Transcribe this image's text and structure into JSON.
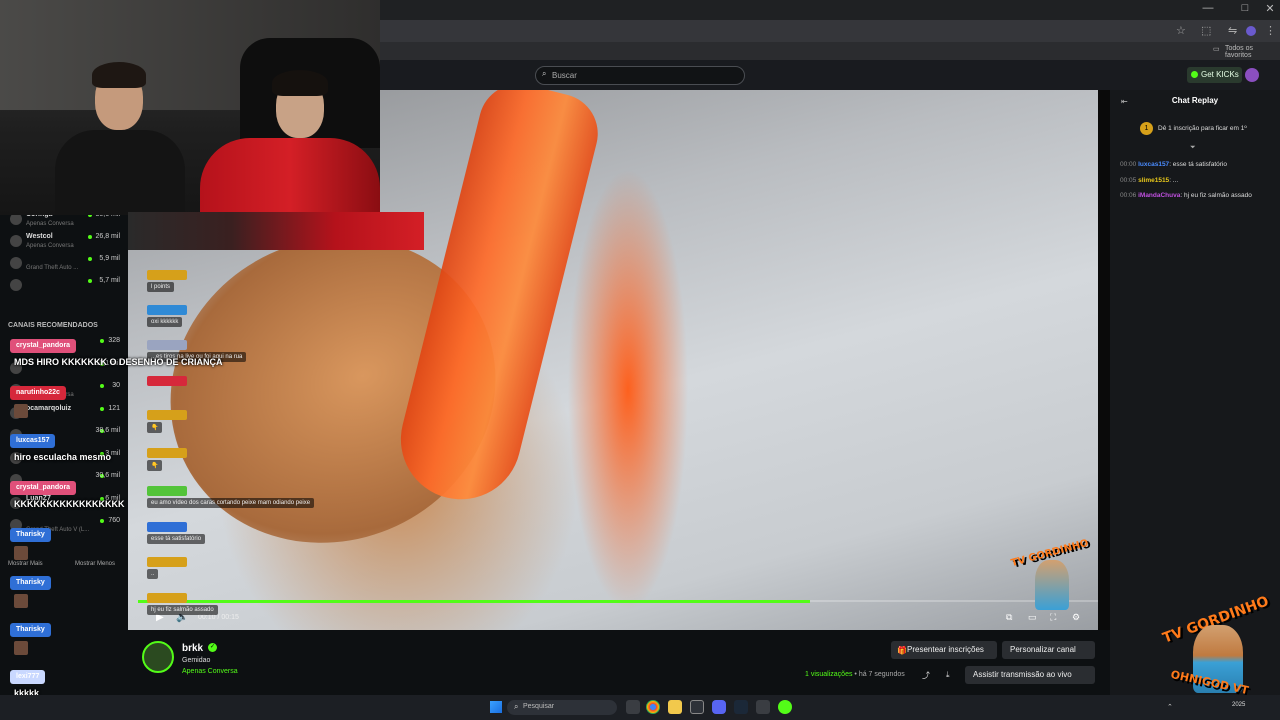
{
  "browser": {
    "window_controls": [
      "—",
      "□",
      "✕"
    ],
    "favorites_label": "Todos os favoritos"
  },
  "header": {
    "search_placeholder": "Buscar",
    "get_kicks_label": "Get KICKs"
  },
  "sidebar": {
    "followed": [
      {
        "name": "Coringa",
        "sub": "Apenas Conversa",
        "count": "30,6 mil"
      },
      {
        "name": "Westcol",
        "sub": "Apenas Conversa",
        "count": "26,8 mil"
      },
      {
        "name": "",
        "sub": "Grand Theft Auto ...",
        "count": "5,9 mil"
      },
      {
        "name": "",
        "sub": "",
        "count": "5,7 mil"
      }
    ],
    "recommended_heading": "CANAIS RECOMENDADOS",
    "recommended": [
      {
        "name": "",
        "sub": "Apenas Conversa",
        "count": "328"
      },
      {
        "name": "",
        "sub": "",
        "count": "15,1 mil"
      },
      {
        "name": "",
        "sub": "Apenas Conversa",
        "count": "30"
      },
      {
        "name": "ocamarqoluiz",
        "sub": "",
        "count": "121"
      },
      {
        "name": "",
        "sub": "",
        "count": "38,6 mil"
      },
      {
        "name": "",
        "sub": "",
        "count": "3 mil"
      },
      {
        "name": "",
        "sub": "",
        "count": "30,6 mil"
      },
      {
        "name": "LuanZ7",
        "sub": "",
        "count": "6 mil"
      },
      {
        "name": "",
        "sub": "Grand Theft Auto V (L...",
        "count": "760"
      }
    ],
    "show_more": "Mostrar Mais",
    "show_less": "Mostrar Menos"
  },
  "overlay_chat_big": [
    {
      "user": "crystal_pandora",
      "color": "#e0507a",
      "message": "MDS HIRO KKKKKKK O DESENHO DE CRIANÇA"
    },
    {
      "user": "narutinho22c",
      "color": "#d6283b",
      "message": ""
    },
    {
      "user": "luxcas157",
      "color": "#2f6fd6",
      "message": "hiro esculacha mesmo"
    },
    {
      "user": "crystal_pandora",
      "color": "#e0507a",
      "message": "KKKKKKKKKKKKKKKKK"
    },
    {
      "user": "Tharisky",
      "color": "#2f6fd6",
      "message": ""
    },
    {
      "user": "Tharisky",
      "color": "#2f6fd6",
      "message": ""
    },
    {
      "user": "Tharisky",
      "color": "#2f6fd6",
      "message": ""
    },
    {
      "user": "lexi777",
      "color": "#c9d8ff",
      "message": "kkkkk"
    }
  ],
  "overlay_chat_small": [
    {
      "color": "#d6a01a",
      "message": "l points"
    },
    {
      "color": "#2f8ad6",
      "message": "oxi kkkkkk"
    },
    {
      "color": "#9aa4c0",
      "message": "...es tiros na live ou foi aqui na rua"
    },
    {
      "color": "#d6283b",
      "message": ""
    },
    {
      "color": "#d6a01a",
      "message": "👇"
    },
    {
      "color": "#d6a01a",
      "message": "👇"
    },
    {
      "color": "#53c43a",
      "message": "eu amo vídeo dos caras cortando peixe mam odiando peixe"
    },
    {
      "color": "#2f6fd6",
      "message": "esse tá satisfatório"
    },
    {
      "color": "#d6a01a",
      "message": ".."
    },
    {
      "color": "#d6a01a",
      "message": "hj eu fiz salmão assado"
    }
  ],
  "player": {
    "time": "00:10 / 00:15",
    "progress": 0.7
  },
  "chat_replay": {
    "title": "Chat Replay",
    "pinned": "Dê 1 inscrição para ficar em 1º",
    "messages": [
      {
        "time": "00:00",
        "user": "luxcas157",
        "user_color": "#4a8cff",
        "text": ": esse tá satisfatório"
      },
      {
        "time": "00:05",
        "user": "slime1515",
        "user_color": "#e8c81a",
        "text": ": ..."
      },
      {
        "time": "00:06",
        "user": "iMandaChuva",
        "user_color": "#c050e0",
        "text": ": hj eu fiz salmão assado"
      }
    ]
  },
  "channel": {
    "name": "brkk",
    "stream_title": "Gemidao",
    "category": "Apenas Conversa",
    "views": "1 visualizações",
    "ago": "há 7 segundos",
    "gift_label": "Presentear inscrições",
    "customize_label": "Personalizar canal",
    "watch_live_label": "Assistir transmissão ao vivo"
  },
  "taskbar": {
    "search_placeholder": "Pesquisar",
    "date": "2025"
  },
  "watermark": {
    "text_top": "TV GORDINHO",
    "text_bottom": "OHNIGOD VT"
  },
  "colors": {
    "accent": "#53fc18",
    "bg": "#0b0e0f"
  }
}
